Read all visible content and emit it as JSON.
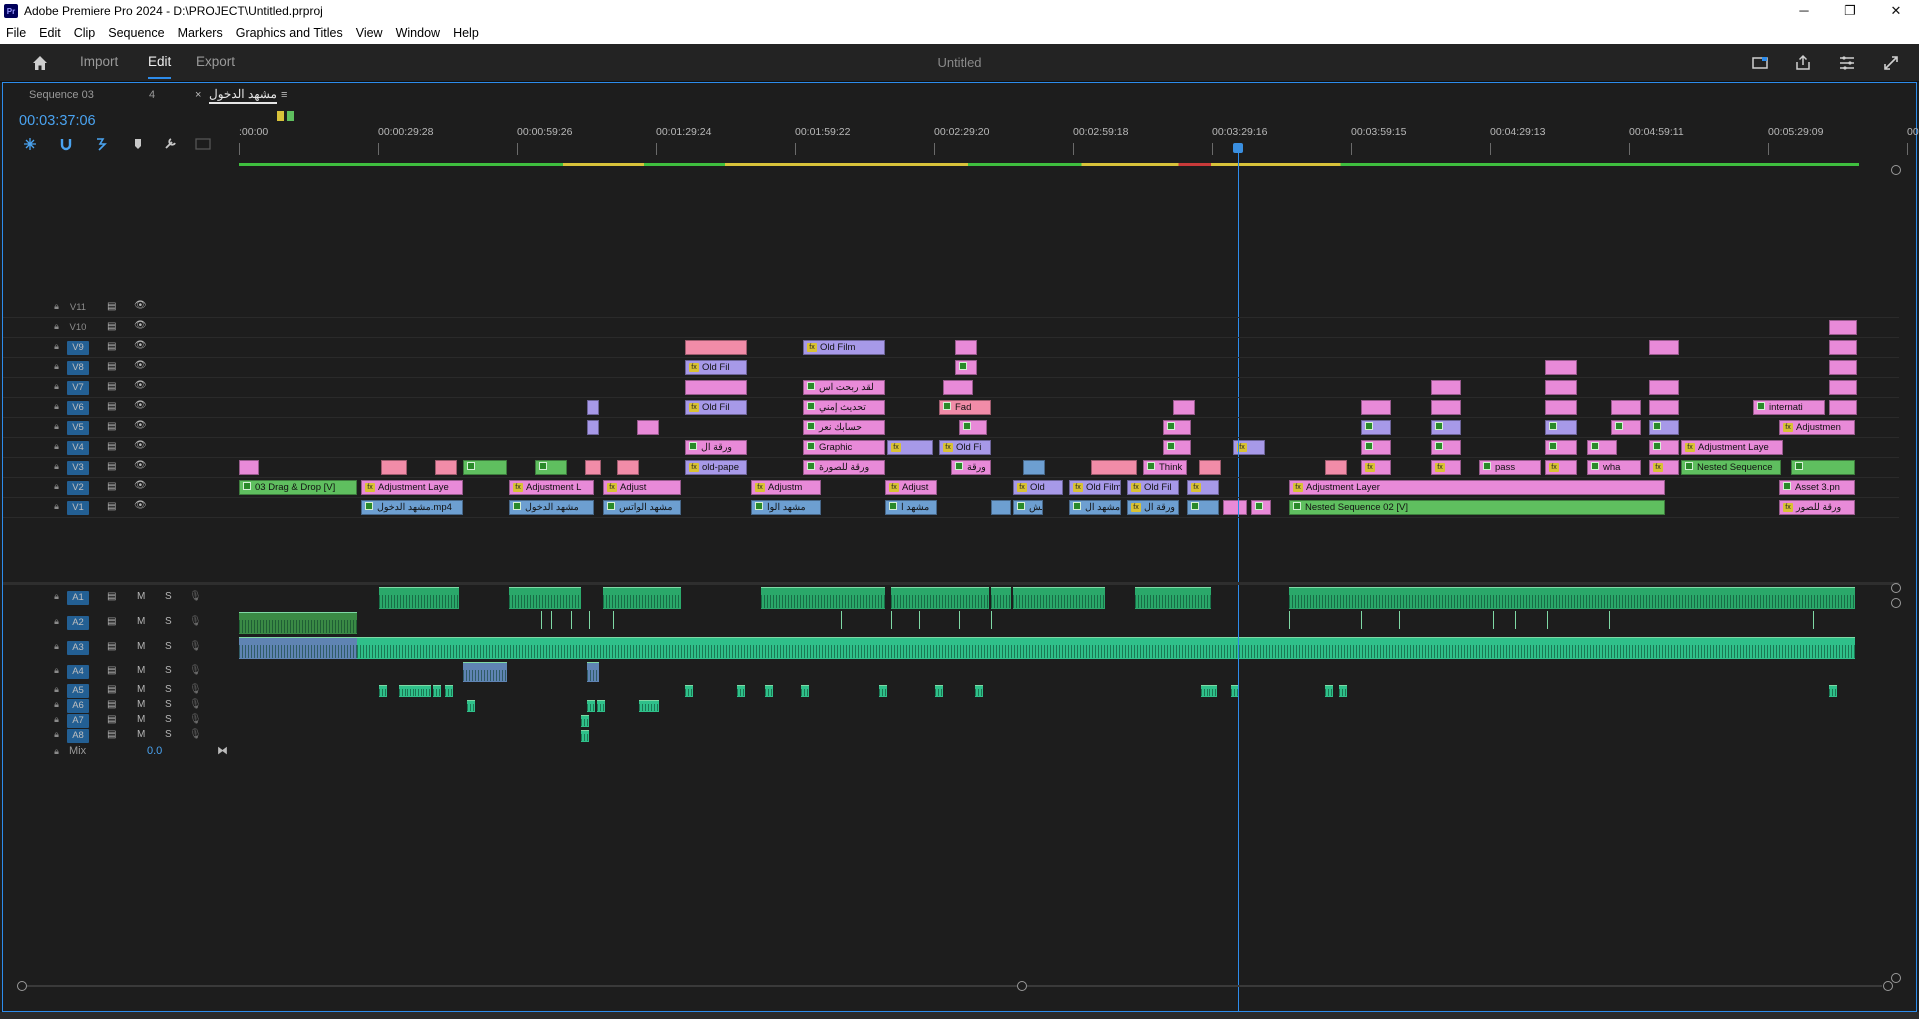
{
  "window": {
    "title": "Adobe Premiere Pro 2024 - D:\\PROJECT\\Untitled.prproj",
    "app_icon": "Pr",
    "controls": [
      "─",
      "❐",
      "✕"
    ]
  },
  "menu": [
    "File",
    "Edit",
    "Clip",
    "Sequence",
    "Markers",
    "Graphics and Titles",
    "View",
    "Window",
    "Help"
  ],
  "workspace": {
    "tabs": [
      "Import",
      "Edit",
      "Export"
    ],
    "active": "Edit",
    "document_title": "Untitled"
  },
  "sequence_tabs": {
    "inactive_name": "Sequence 03",
    "inactive_badge": "4",
    "active_close": "×",
    "active_name": "مشهد الدخول",
    "menu_glyph": "≡"
  },
  "timecode": "00:03:37:06",
  "ruler_labels": [
    ":00:00",
    "00:00:29:28",
    "00:00:59:26",
    "00:01:29:24",
    "00:01:59:22",
    "00:02:29:20",
    "00:02:59:18",
    "00:03:29:16",
    "00:03:59:15",
    "00:04:29:13",
    "00:04:59:11",
    "00:05:29:09",
    "00:0"
  ],
  "playhead_fraction": 0.602,
  "video_tracks": [
    "V11",
    "V10",
    "V9",
    "V8",
    "V7",
    "V6",
    "V5",
    "V4",
    "V3",
    "V2",
    "V1"
  ],
  "audio_tracks": [
    "A1",
    "A2",
    "A3",
    "A4",
    "A5",
    "A6",
    "A7",
    "A8"
  ],
  "audio_buttons": {
    "mute": "M",
    "solo": "S"
  },
  "mix": {
    "label": "Mix",
    "value": "0.0"
  },
  "clips": {
    "v2_dragdrop": "03 Drag & Drop [V]",
    "v2_adj1": "Adjustment Laye",
    "v2_adj2": "Adjustment L",
    "v2_adj3": "Adjust",
    "v2_adj4": "Adjustm",
    "v2_adj5": "Adjust",
    "v2_old1": "Old",
    "v2_oldfilm": "Old Film",
    "v2_oldfi": "Old Fil",
    "v2_adjbig": "Adjustment Layer",
    "v2_asset": "Asset 3.pn",
    "v1_entry": "مشهد الدخول.mp4",
    "v1_entry2": "مشهد الدخول",
    "v1_entry3": "مشهد الواتس",
    "v1_entry4": "مشهد الوا",
    "v1_entry5": "مشهد ا",
    "v1_entry6": "مش",
    "v1_entry7": "مشهد ال",
    "v1_paper": "ورقة ال",
    "v1_nested": "Nested Sequence 02 [V]",
    "v1_photos": "ورقة للصور",
    "v3_oldpaper": "old-pape",
    "v3_photo": "ورقة للصورة",
    "v3_paper2": "ورقة",
    "v3_think": "Think",
    "v3_pass": "pass",
    "v3_wha": "wha",
    "v3_nested": "Nested Sequence",
    "v4_paper": "ورقة ال",
    "v4_graphic": "Graphic",
    "v4_oldfi": "Old Fi",
    "v4_adj": "Adjustment Laye",
    "v5_account": "حسابك نعر",
    "v5_adj": "Adjustmen",
    "v6_oldfil": "Old Fil",
    "v6_update": "تحديث إمني",
    "v6_fad": "Fad",
    "v6_intl": "internati",
    "v7_profit": "لقد ربحت اس",
    "v8_oldfil": "Old Fil",
    "v9_oldfilm": "Old Film"
  },
  "colors": {
    "accent_blue": "#2d8ceb",
    "timecode": "#4aa3f0",
    "pink_clip": "#e88ad8",
    "lavender_clip": "#a799e8",
    "blue_clip": "#6d9fd1",
    "green_clip": "#5fbf5f",
    "audio_green": "#2aa86a"
  }
}
